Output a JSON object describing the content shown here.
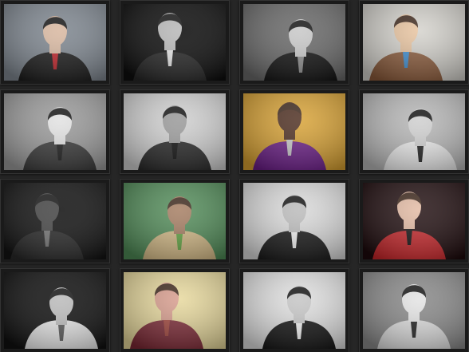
{
  "gallery": {
    "items": [
      {
        "theme": "bw",
        "bg": "#7f8790",
        "fg": "#1c1c1c",
        "skin": "#d9b9a2",
        "accent": "#c0252b"
      },
      {
        "theme": "bw",
        "bg": "#0e0e0e",
        "fg": "#272727",
        "skin": "#b9b9b9",
        "accent": "#e8e8e8"
      },
      {
        "theme": "bw",
        "bg": "#6a6a6a",
        "fg": "#131313",
        "skin": "#c9c9c9",
        "accent": "#8e8e8e"
      },
      {
        "theme": "color",
        "bg": "#d3d1cb",
        "fg": "#8a5a3a",
        "skin": "#e7c29d",
        "accent": "#3c8ed3"
      },
      {
        "theme": "bw",
        "bg": "#9b9b9b",
        "fg": "#3a3a3a",
        "skin": "#e2e2e2",
        "accent": "#1d1d1d"
      },
      {
        "theme": "bw",
        "bg": "#cfcfcf",
        "fg": "#2a2a2a",
        "skin": "#9c9c9c",
        "accent": "#111111"
      },
      {
        "theme": "color",
        "bg": "#d7a031",
        "fg": "#6a1d86",
        "skin": "#4a2a1c",
        "accent": "#c9c9c9"
      },
      {
        "theme": "bw",
        "bg": "#b7b7b7",
        "fg": "#eaeaea",
        "skin": "#d0d0d0",
        "accent": "#222222"
      },
      {
        "theme": "bw",
        "bg": "#141414",
        "fg": "#2a2a2a",
        "skin": "#474747",
        "accent": "#777777"
      },
      {
        "theme": "color",
        "bg": "#4f8a56",
        "fg": "#d3b985",
        "skin": "#a37a5e",
        "accent": "#5fa340"
      },
      {
        "theme": "bw",
        "bg": "#d9d9d9",
        "fg": "#1a1a1a",
        "skin": "#bdbdbd",
        "accent": "#f1f1f1"
      },
      {
        "theme": "color",
        "bg": "#1d0a0c",
        "fg": "#c8262a",
        "skin": "#e2b9a2",
        "accent": "#101010"
      },
      {
        "theme": "bw",
        "bg": "#111111",
        "fg": "#e6e6e6",
        "skin": "#bcbcbc",
        "accent": "#5a5a5a"
      },
      {
        "theme": "color",
        "bg": "#e6d79a",
        "fg": "#7b2834",
        "skin": "#d69a8a",
        "accent": "#a1443a"
      },
      {
        "theme": "bw",
        "bg": "#dedede",
        "fg": "#151515",
        "skin": "#c7c7c7",
        "accent": "#f2f2f2"
      },
      {
        "theme": "bw",
        "bg": "#8a8a8a",
        "fg": "#dcdcdc",
        "skin": "#e4e4e4",
        "accent": "#232323"
      }
    ]
  }
}
